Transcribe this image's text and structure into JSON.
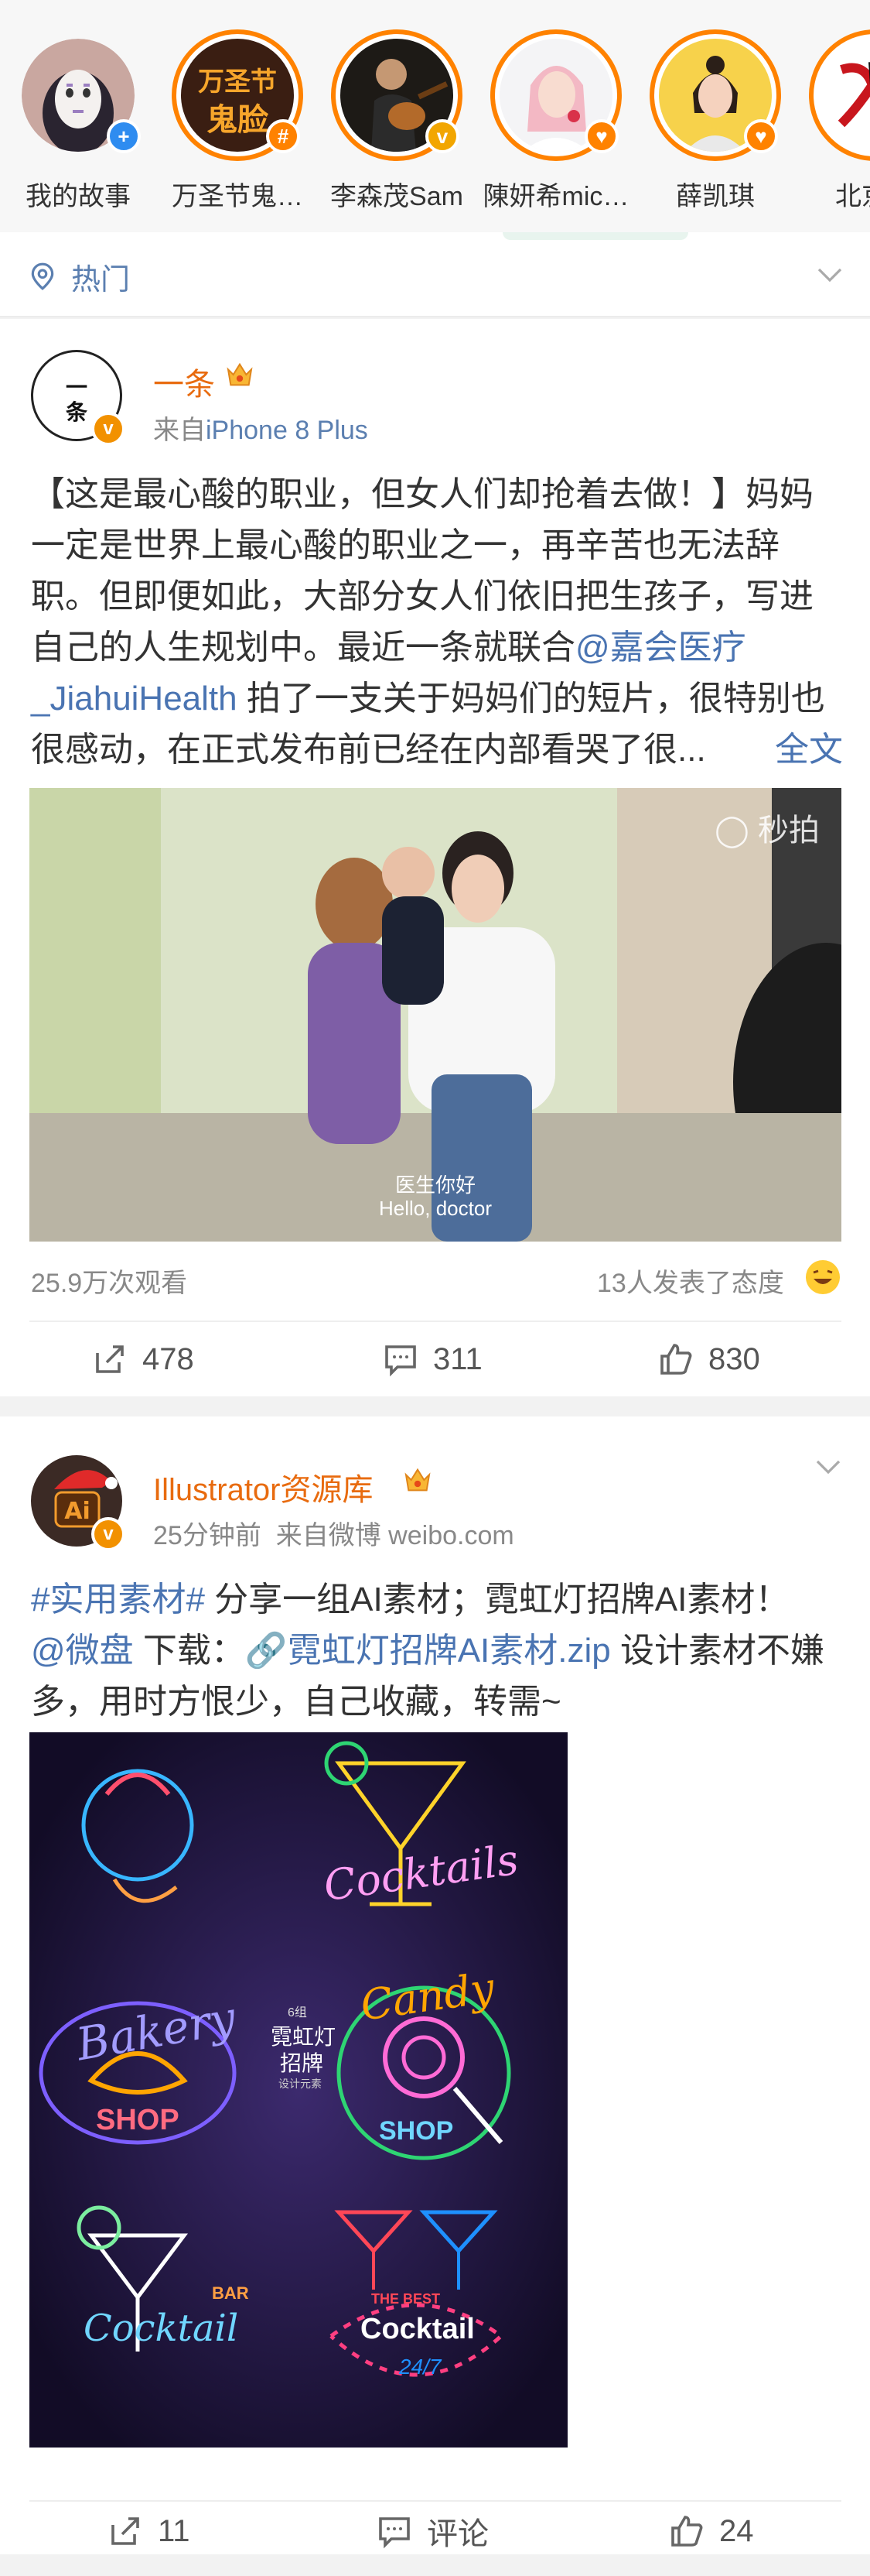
{
  "stories": [
    {
      "label": "我的故事",
      "badge": "+",
      "badge_color": "#2e8cf0",
      "icon": "no-face-avatar"
    },
    {
      "label": "万圣节鬼…",
      "badge": "#",
      "badge_color": "#ff8200",
      "icon": "halloween-avatar",
      "art_top": "万圣节",
      "art_bottom": "鬼脸"
    },
    {
      "label": "李森茂Sam",
      "badge": "v",
      "badge_color": "#f2a600",
      "icon": "guitarist-avatar"
    },
    {
      "label": "陳妍希mic…",
      "badge": "♥",
      "badge_color": "#ff8200",
      "icon": "woman-avatar"
    },
    {
      "label": "薛凯琪",
      "badge": "♥",
      "badge_color": "#ff8200",
      "icon": "woman-avatar-2"
    },
    {
      "label": "北京李",
      "badge": "",
      "badge_color": "#ff8200",
      "icon": "partial-avatar"
    }
  ],
  "hot": {
    "label": "热门"
  },
  "post1": {
    "avatar_text_top": "一",
    "avatar_text_bottom": "条",
    "username": "一条",
    "meta_prefix": "来自",
    "meta_source": "iPhone 8 Plus",
    "text_main": "【这是最心酸的职业，但女人们却抢着去做！】妈妈一定是世界上最心酸的职业之一，再辛苦也无法辞职。但即便如此，大部分女人们依旧把生孩子，写进自己的人生规划中。最近一条就联合",
    "mention": "@嘉会医疗_JiahuiHealth",
    "text_after": " 拍了一支关于妈妈们的短片，很特别也很感动，在正式发布前已经在内部看哭了很...",
    "more": "全文",
    "video_watermark": "秒拍",
    "video_sub_cn": "医生你好",
    "video_sub_en": "Hello, doctor",
    "views": "25.9万次观看",
    "reactions": "13人发表了态度",
    "repost": "478",
    "comment": "311",
    "like": "830"
  },
  "post2": {
    "username": "Illustrator资源库",
    "time": "25分钟前",
    "source": "来自微博 weibo.com",
    "tag": "#实用素材#",
    "text1": " 分享一组AI素材；霓虹灯招牌AI素材！",
    "mention": "@微盘",
    "download": " 下载：",
    "file": "霓虹灯招牌AI素材.zip",
    "text2": " 设计素材不嫌多，用时方恨少，自己收藏，转需~",
    "neon": {
      "cocktails": "Cocktails",
      "bakery": "Bakery",
      "shop": "SHOP",
      "candy": "Candy",
      "candy_shop": "SHOP",
      "center_num": "6组",
      "center_title1": "霓虹灯",
      "center_title2": "招牌",
      "center_sub": "设计元素",
      "bar": "BAR",
      "cocktail": "Cocktail",
      "best": "THE BEST",
      "cocktail2": "Cocktail",
      "hours": "24/7"
    },
    "repost": "11",
    "comment": "评论",
    "like": "24"
  }
}
